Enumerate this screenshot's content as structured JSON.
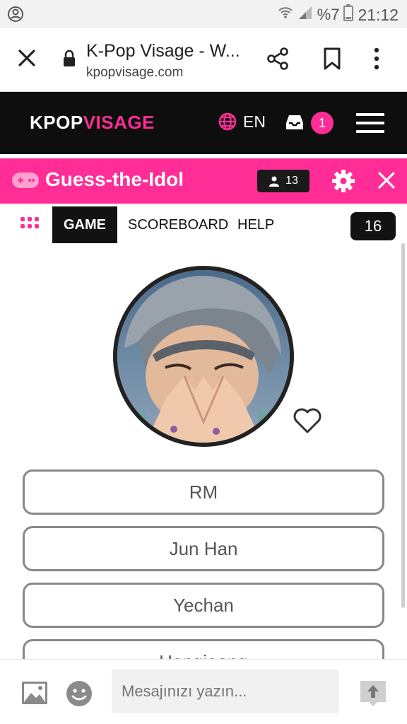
{
  "status_bar": {
    "battery": "%7",
    "time": "21:12"
  },
  "browser": {
    "title": "K-Pop Visage - W...",
    "url": "kpopvisage.com"
  },
  "site": {
    "logo_part1": "KPOP",
    "logo_part2": "VISAGE",
    "language": "EN",
    "notifications": "1"
  },
  "game": {
    "title": "Guess-the-Idol",
    "players": "13",
    "tabs": [
      "GAME",
      "SCOREBOARD",
      "HELP"
    ],
    "counter": "16"
  },
  "answers": [
    "RM",
    "Jun Han",
    "Yechan",
    "Hongjoong"
  ],
  "chat": {
    "placeholder": "Mesajınızı yazın..."
  },
  "colors": {
    "brand_pink": "#ff2d95",
    "header_black": "#0e0e0e"
  }
}
